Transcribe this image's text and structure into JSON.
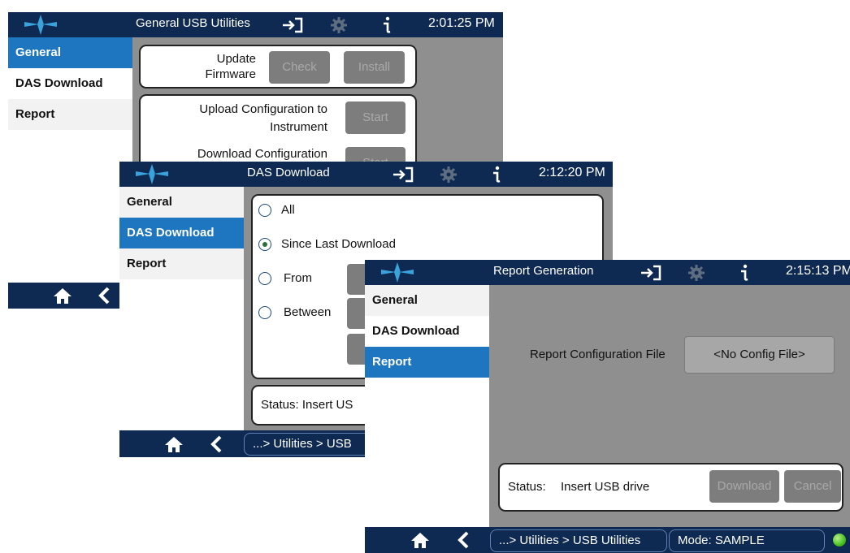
{
  "nav_items": [
    "General",
    "DAS Download",
    "Report"
  ],
  "win1": {
    "title": "General USB Utilities",
    "time": "2:01:25 PM",
    "update_label": "Update Firmware",
    "check_label": "Check",
    "install_label": "Install",
    "upload_label": "Upload Configuration to Instrument",
    "start_label": "Start",
    "download_label": "Download Configuration",
    "start2_label": "Start"
  },
  "win2": {
    "title": "DAS Download",
    "time": "2:12:20 PM",
    "options": [
      "All",
      "Since Last Download",
      "From",
      "Between"
    ],
    "selected_option": "Since Last Download",
    "status_text": "Status:  Insert US",
    "breadcrumb": "...> Utilities > USB"
  },
  "win3": {
    "title": "Report Generation",
    "time": "2:15:13 PM",
    "config_label": "Report Configuration File",
    "config_value": "<No Config File>",
    "status_label": "Status:",
    "status_value": "Insert USB drive",
    "download_label": "Download",
    "cancel_label": "Cancel",
    "breadcrumb": "...> Utilities > USB Utilities",
    "mode": "Mode: SAMPLE"
  },
  "colors": {
    "titlebar": "#0f2a52",
    "selected": "#1e76c0",
    "panel": "#8f8f8f",
    "status_led": "#46c21f"
  },
  "icons": [
    "logo-icon",
    "exit-icon",
    "gear-icon",
    "info-icon",
    "home-icon",
    "back-icon"
  ]
}
